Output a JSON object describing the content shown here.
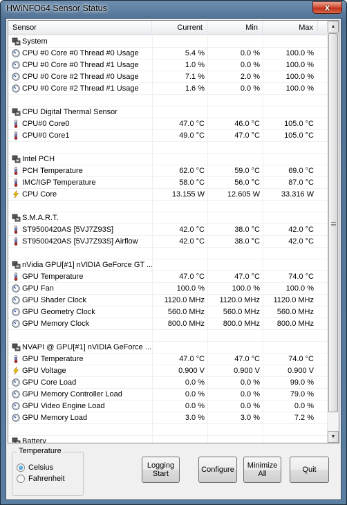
{
  "window": {
    "title": "HWiNFO64 Sensor Status",
    "close_glyph": "x"
  },
  "columns": {
    "sensor": "Sensor",
    "current": "Current",
    "min": "Min",
    "max": "Max"
  },
  "scrollbar": {
    "up_glyph": "▲",
    "down_glyph": "▼"
  },
  "rows": [
    {
      "type": "group",
      "icon": "chip-icon",
      "name": "System"
    },
    {
      "type": "item",
      "icon": "gauge-icon",
      "name": "CPU #0 Core #0 Thread #0 Usage",
      "current": "5.4 %",
      "min": "0.0 %",
      "max": "100.0 %"
    },
    {
      "type": "item",
      "icon": "gauge-icon",
      "name": "CPU #0 Core #0 Thread #1 Usage",
      "current": "1.0 %",
      "min": "0.0 %",
      "max": "100.0 %"
    },
    {
      "type": "item",
      "icon": "gauge-icon",
      "name": "CPU #0 Core #2 Thread #0 Usage",
      "current": "7.1 %",
      "min": "2.0 %",
      "max": "100.0 %"
    },
    {
      "type": "item",
      "icon": "gauge-icon",
      "name": "CPU #0 Core #2 Thread #1 Usage",
      "current": "1.6 %",
      "min": "0.0 %",
      "max": "100.0 %"
    },
    {
      "type": "empty"
    },
    {
      "type": "group",
      "icon": "chip-icon",
      "name": "CPU Digital Thermal Sensor"
    },
    {
      "type": "item",
      "icon": "thermometer-icon",
      "name": "CPU#0 Core0",
      "current": "47.0 °C",
      "min": "46.0 °C",
      "max": "105.0 °C"
    },
    {
      "type": "item",
      "icon": "thermometer-icon",
      "name": "CPU#0 Core1",
      "current": "49.0 °C",
      "min": "47.0 °C",
      "max": "105.0 °C"
    },
    {
      "type": "empty"
    },
    {
      "type": "group",
      "icon": "chip-icon",
      "name": "Intel PCH"
    },
    {
      "type": "item",
      "icon": "thermometer-icon",
      "name": "PCH Temperature",
      "current": "62.0 °C",
      "min": "59.0 °C",
      "max": "69.0 °C"
    },
    {
      "type": "item",
      "icon": "thermometer-icon",
      "name": "IMC/IGP Temperature",
      "current": "58.0 °C",
      "min": "56.0 °C",
      "max": "87.0 °C"
    },
    {
      "type": "item",
      "icon": "lightning-icon",
      "name": "CPU Core",
      "current": "13.155 W",
      "min": "12.605 W",
      "max": "33.316 W"
    },
    {
      "type": "empty"
    },
    {
      "type": "group",
      "icon": "chip-icon",
      "name": "S.M.A.R.T."
    },
    {
      "type": "item",
      "icon": "thermometer-icon",
      "name": "ST9500420AS [5VJ7Z93S]",
      "current": "42.0 °C",
      "min": "38.0 °C",
      "max": "42.0 °C"
    },
    {
      "type": "item",
      "icon": "thermometer-icon",
      "name": "ST9500420AS [5VJ7Z93S] Airflow",
      "current": "42.0 °C",
      "min": "38.0 °C",
      "max": "42.0 °C"
    },
    {
      "type": "empty"
    },
    {
      "type": "group",
      "icon": "chip-icon",
      "name": "nVidia GPU[#1] nVIDIA GeForce GT ..."
    },
    {
      "type": "item",
      "icon": "thermometer-icon",
      "name": "GPU Temperature",
      "current": "47.0 °C",
      "min": "47.0 °C",
      "max": "74.0 °C"
    },
    {
      "type": "item",
      "icon": "gauge-icon",
      "name": "GPU Fan",
      "current": "100.0 %",
      "min": "100.0 %",
      "max": "100.0 %"
    },
    {
      "type": "item",
      "icon": "gauge-icon",
      "name": "GPU Shader Clock",
      "current": "1120.0 MHz",
      "min": "1120.0 MHz",
      "max": "1120.0 MHz"
    },
    {
      "type": "item",
      "icon": "gauge-icon",
      "name": "GPU Geometry Clock",
      "current": "560.0 MHz",
      "min": "560.0 MHz",
      "max": "560.0 MHz"
    },
    {
      "type": "item",
      "icon": "gauge-icon",
      "name": "GPU Memory Clock",
      "current": "800.0 MHz",
      "min": "800.0 MHz",
      "max": "800.0 MHz"
    },
    {
      "type": "empty"
    },
    {
      "type": "group",
      "icon": "chip-icon",
      "name": "NVAPI @ GPU[#1] nVIDIA GeForce ..."
    },
    {
      "type": "item",
      "icon": "thermometer-icon",
      "name": "GPU Temperature",
      "current": "47.0 °C",
      "min": "47.0 °C",
      "max": "74.0 °C"
    },
    {
      "type": "item",
      "icon": "lightning-icon",
      "name": "GPU Voltage",
      "current": "0.900 V",
      "min": "0.900 V",
      "max": "0.900 V"
    },
    {
      "type": "item",
      "icon": "gauge-icon",
      "name": "GPU Core Load",
      "current": "0.0 %",
      "min": "0.0 %",
      "max": "99.0 %"
    },
    {
      "type": "item",
      "icon": "gauge-icon",
      "name": "GPU Memory Controller Load",
      "current": "0.0 %",
      "min": "0.0 %",
      "max": "79.0 %"
    },
    {
      "type": "item",
      "icon": "gauge-icon",
      "name": "GPU Video Engine Load",
      "current": "0.0 %",
      "min": "0.0 %",
      "max": "0.0 %"
    },
    {
      "type": "item",
      "icon": "gauge-icon",
      "name": "GPU Memory Load",
      "current": "3.0 %",
      "min": "3.0 %",
      "max": "7.2 %"
    },
    {
      "type": "empty"
    },
    {
      "type": "group",
      "icon": "chip-icon",
      "name": "Battery"
    }
  ],
  "temperature": {
    "legend": "Temperature",
    "celsius": "Celsius",
    "fahrenheit": "Fahrenheit",
    "selected": "Celsius"
  },
  "buttons": {
    "logging_line1": "Logging",
    "logging_line2": "Start",
    "configure": "Configure",
    "minimize_line1": "Minimize",
    "minimize_line2": "All",
    "quit": "Quit"
  }
}
